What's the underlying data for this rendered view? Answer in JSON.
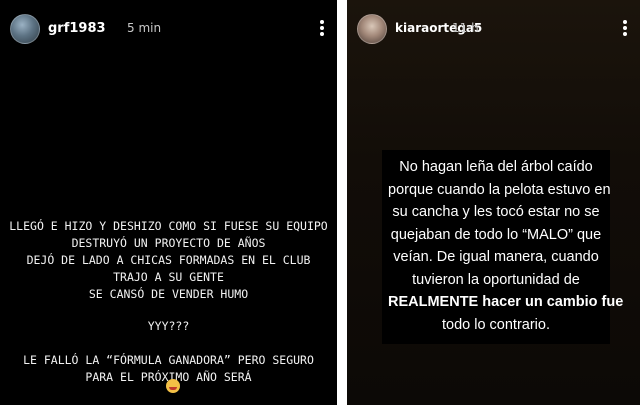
{
  "left_story": {
    "username": "grf1983",
    "time": "5 min",
    "lines_block1": [
      "LLEGÓ E HIZO Y DESHIZO COMO SI FUESE SU EQUIPO",
      "DESTRUYÓ UN PROYECTO DE AÑOS",
      "DEJÓ DE LADO A CHICAS FORMADAS EN EL CLUB",
      "TRAJO A SU GENTE",
      "SE CANSÓ DE VENDER HUMO"
    ],
    "line_question": "YYY???",
    "lines_block2": [
      "LE FALLÓ LA “FÓRMULA GANADORA” PERO SEGURO",
      "PARA EL PRÓXIMO AÑO SERÁ"
    ],
    "emoji": "clown-face-emoji"
  },
  "right_story": {
    "username": "kiaraortega5",
    "time": "11 h",
    "text_lines": [
      "No hagan leña del árbol caído",
      "porque cuando la pelota estuvo en",
      "su cancha y les tocó estar no se",
      "quejaban de todo lo “MALO” que",
      "veían. De igual manera, cuando",
      "tuvieron la oportunidad de",
      "REALMENTE hacer un cambio fue",
      "todo lo contrario."
    ]
  },
  "colors": {
    "left_bg": "#000000",
    "right_bg": "#150f09",
    "card_bg": "#000000",
    "text": "#ffffff",
    "meta_text": "#c8c8c8"
  }
}
